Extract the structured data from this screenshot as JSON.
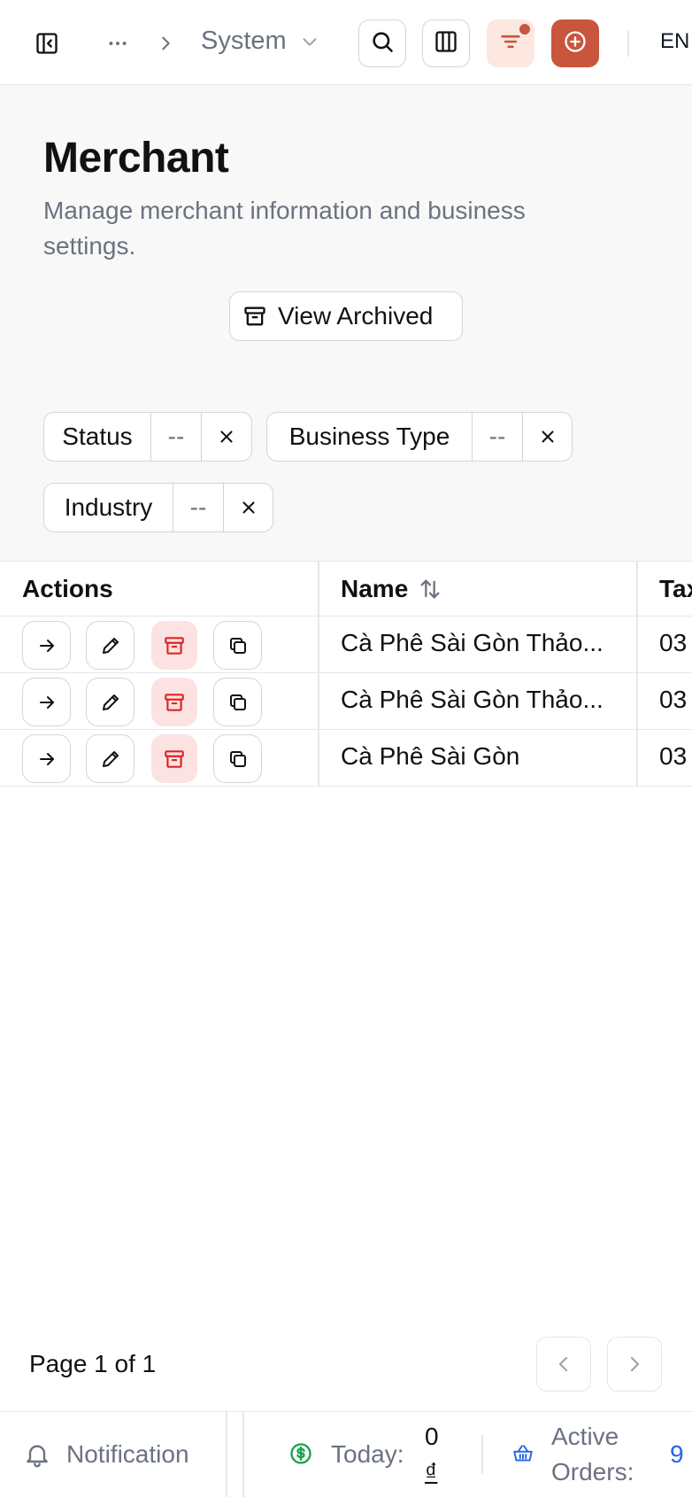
{
  "colors": {
    "accent": "#c8553d",
    "accent_soft": "#fde7e1",
    "danger": "#dc2626",
    "danger_soft": "#fde2e2",
    "success": "#16a34a",
    "link": "#2563eb"
  },
  "topbar": {
    "breadcrumb": {
      "section": "System"
    },
    "language": "EN",
    "icons": [
      "sidebar-toggle-icon",
      "ellipsis-icon",
      "chevron-right-icon",
      "chevron-down-icon",
      "search-icon",
      "columns-icon",
      "filter-icon",
      "plus-circle-icon"
    ]
  },
  "page": {
    "title": "Merchant",
    "description": "Manage merchant information and business settings.",
    "view_archived_label": "View Archived"
  },
  "filters": [
    {
      "label": "Status",
      "value": "--"
    },
    {
      "label": "Business Type",
      "value": "--"
    },
    {
      "label": "Industry",
      "value": "--"
    }
  ],
  "table": {
    "headers": {
      "actions": "Actions",
      "name": "Name",
      "tax": "Tax"
    },
    "rows": [
      {
        "name": "Cà Phê Sài Gòn Thảo...",
        "tax": "03"
      },
      {
        "name": "Cà Phê Sài Gòn Thảo...",
        "tax": "03"
      },
      {
        "name": "Cà Phê Sài Gòn",
        "tax": "03"
      }
    ]
  },
  "pagination": {
    "label": "Page 1 of 1"
  },
  "footer": {
    "notification_label": "Notification",
    "today_label": "Today:",
    "today_value": "0",
    "today_currency": "₫",
    "active_orders_label": "Active",
    "active_orders_label2": "Orders:",
    "active_orders_value": "9"
  }
}
